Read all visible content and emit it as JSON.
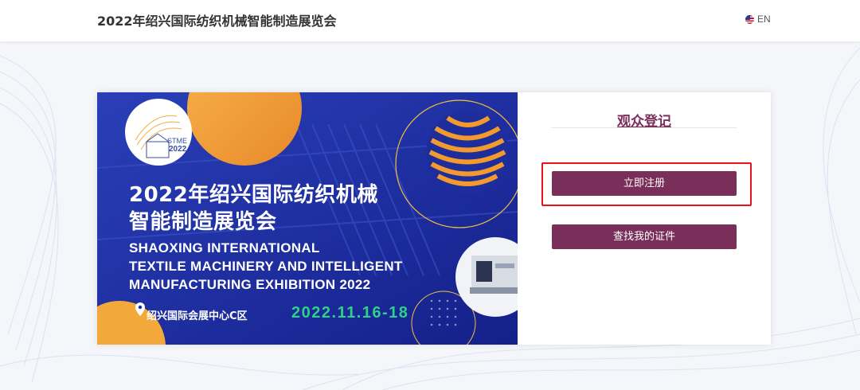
{
  "header": {
    "site_title": "2022年绍兴国际纺织机械智能制造展览会",
    "lang_label": "EN",
    "flag_icon": "us-flag-icon"
  },
  "banner": {
    "logo_text": "STME",
    "logo_year": "2022",
    "title_cn_line1": "2022年绍兴国际纺织机械",
    "title_cn_line2": "智能制造展览会",
    "title_en_line1": "SHAOXING INTERNATIONAL",
    "title_en_line2": "TEXTILE MACHINERY AND INTELLIGENT",
    "title_en_line3": "MANUFACTURING EXHIBITION 2022",
    "location": "绍兴国际会展中心C区",
    "location_icon": "location-pin-icon",
    "dates": "2022.11.16-18"
  },
  "panel": {
    "title": "观众登记",
    "register_button": "立即注册",
    "find_badge_button": "查找我的证件"
  },
  "colors": {
    "accent": "#7a2f5a",
    "highlight": "#e8111b",
    "banner_bg": "#1d2d9c",
    "date_green": "#2fd08a"
  }
}
